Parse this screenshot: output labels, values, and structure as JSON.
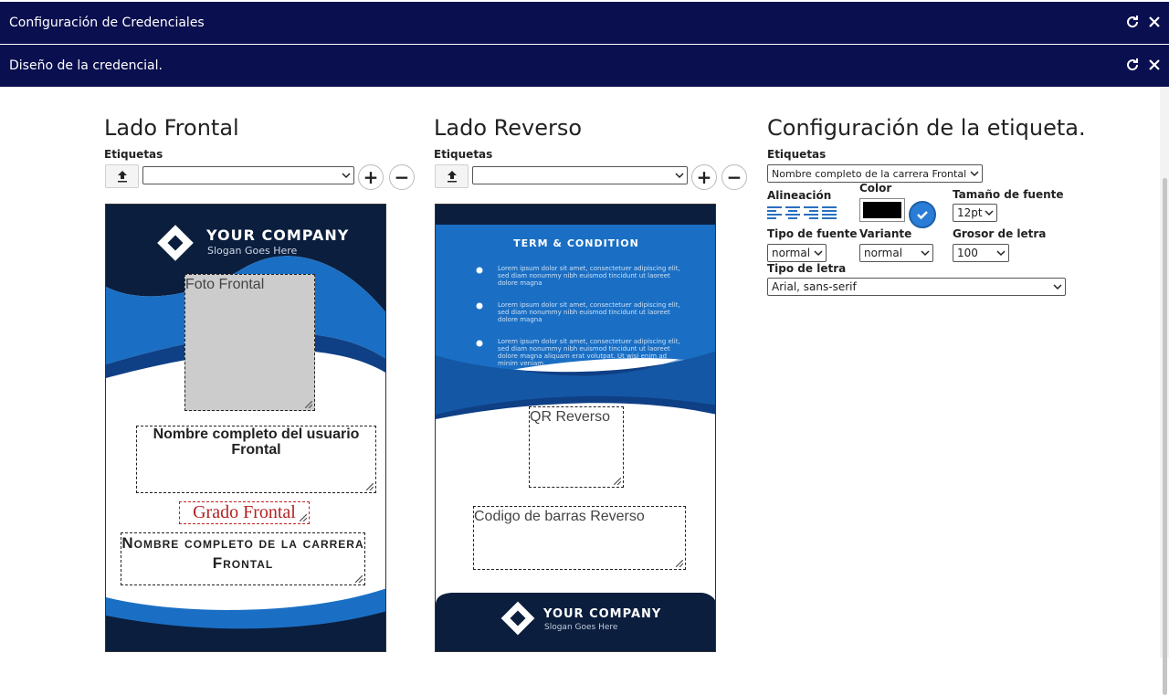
{
  "window": {
    "title": "Configuración de Credenciales",
    "subtitle": "Diseño de la credencial."
  },
  "front": {
    "heading": "Lado Frontal",
    "tags_label": "Etiquetas",
    "company": "YOUR COMPANY",
    "slogan": "Slogan Goes Here",
    "photo_label": "Foto Frontal",
    "user_name": "Nombre completo del usuario Frontal",
    "grade": "Grado Frontal",
    "career": "Nombre completo de la carrera Frontal"
  },
  "back": {
    "heading": "Lado Reverso",
    "tags_label": "Etiquetas",
    "terms_title": "TERM & CONDITION",
    "terms_text": "Lorem ipsum dolor sit amet, consectetuer adipiscing elit, sed diam nonummy nibh euismod tincidunt ut laoreet dolore magna",
    "terms_text_last": "Lorem ipsum dolor sit amet, consectetuer adipiscing elit, sed diam nonummy nibh euismod tincidunt ut laoreet dolore magna aliquam erat volutpat. Ut wisi enim ad minim veniam.",
    "qr_label": "QR Reverso",
    "barcode_label": "Codigo de barras Reverso",
    "company": "YOUR COMPANY",
    "slogan": "Slogan Goes Here"
  },
  "config": {
    "heading": "Configuración de la etiqueta.",
    "tags_label": "Etiquetas",
    "tag_selected": "Nombre completo de la carrera Frontal",
    "align_label": "Alineación",
    "color_label": "Color",
    "font_size_label": "Tamaño de fuente",
    "font_size": "12pt",
    "font_type_label": "Tipo de fuente",
    "font_type": "normal",
    "variant_label": "Variante",
    "variant": "normal",
    "weight_label": "Grosor de letra",
    "weight": "100",
    "family_label": "Tipo de letra",
    "family": "Arial, sans-serif",
    "color_value": "#000000",
    "accent": "#2a7dd6"
  },
  "colors": {
    "titlebar": "#0a0f4f",
    "card_navy": "#0b1e3d",
    "card_blue": "#1a6fc4"
  }
}
